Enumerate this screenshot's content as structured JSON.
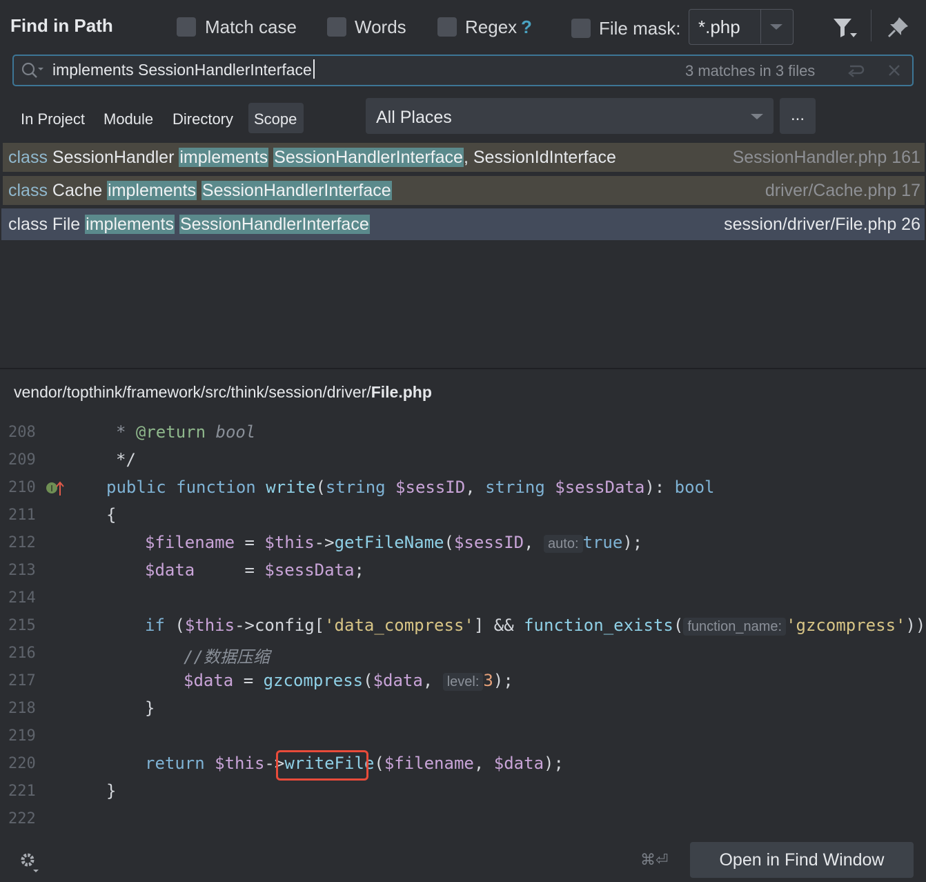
{
  "header": {
    "title": "Find in Path",
    "match_case": "Match case",
    "words": "Words",
    "regex": "Regex",
    "regex_help": "?",
    "file_mask_label": "File mask:",
    "file_mask_value": "*.php"
  },
  "search": {
    "query": "implements SessionHandlerInterface",
    "match_count": "3 matches in 3 files"
  },
  "scope": {
    "tabs": [
      "In Project",
      "Module",
      "Directory",
      "Scope"
    ],
    "selected_tab": "Scope",
    "places": "All Places",
    "more": "..."
  },
  "results": [
    {
      "kw": "class",
      "name": "SessionHandler",
      "m1": "implements",
      "m2": "SessionHandlerInterface",
      "rest": ", SessionIdInterface",
      "file": "SessionHandler.php 161"
    },
    {
      "kw": "class",
      "name": "Cache",
      "m1": "implements",
      "m2": "SessionHandlerInterface",
      "rest": "",
      "file": "driver/Cache.php 17"
    },
    {
      "kw": "class",
      "name": "File",
      "m1": "implements",
      "m2": "SessionHandlerInterface",
      "rest": "",
      "file": "session/driver/File.php 26"
    }
  ],
  "preview": {
    "path_prefix": "vendor/topthink/framework/src/think/session/driver/",
    "path_file": "File.php",
    "line_numbers": [
      "208",
      "209",
      "210",
      "211",
      "212",
      "213",
      "214",
      "215",
      "216",
      "217",
      "218",
      "219",
      "220",
      "221",
      "222"
    ],
    "l208_a": "* ",
    "l208_b": "@return",
    "l208_c": " bool",
    "l209": "*/",
    "l210_a": "public function ",
    "l210_b": "write",
    "l210_c": "(",
    "l210_d": "string ",
    "l210_e": "$sessID",
    "l210_f": ", ",
    "l210_g": "string ",
    "l210_h": "$sessData",
    "l210_i": "): ",
    "l210_j": "bool",
    "l211": "{",
    "l212_a": "$filename",
    "l212_b": " = ",
    "l212_c": "$this",
    "l212_d": "->",
    "l212_e": "getFileName",
    "l212_f": "(",
    "l212_g": "$sessID",
    "l212_h": ", ",
    "l212_hint": "auto:",
    "l212_i": "true",
    "l212_j": ");",
    "l213_a": "$data",
    "l213_b": "     = ",
    "l213_c": "$sessData",
    "l213_d": ";",
    "l215_a": "if",
    "l215_b": " (",
    "l215_c": "$this",
    "l215_d": "->config[",
    "l215_e": "'data_compress'",
    "l215_f": "] && ",
    "l215_g": "function_exists",
    "l215_h": "(",
    "l215_hint": "function_name:",
    "l215_i": "'gzcompress'",
    "l215_j": "))",
    "l216": "//数据压缩",
    "l217_a": "$data",
    "l217_b": " = ",
    "l217_c": "gzcompress",
    "l217_d": "(",
    "l217_e": "$data",
    "l217_f": ", ",
    "l217_hint": "level:",
    "l217_g": "3",
    "l217_h": ");",
    "l218": "}",
    "l220_a": "return",
    "l220_b": " ",
    "l220_c": "$this",
    "l220_d": "->",
    "l220_e": "writeFile",
    "l220_f": "(",
    "l220_g": "$filename",
    "l220_h": ", ",
    "l220_i": "$data",
    "l220_j": ");",
    "l221": "}"
  },
  "footer": {
    "shortcut": "⌘⏎",
    "open_button": "Open in Find Window"
  }
}
